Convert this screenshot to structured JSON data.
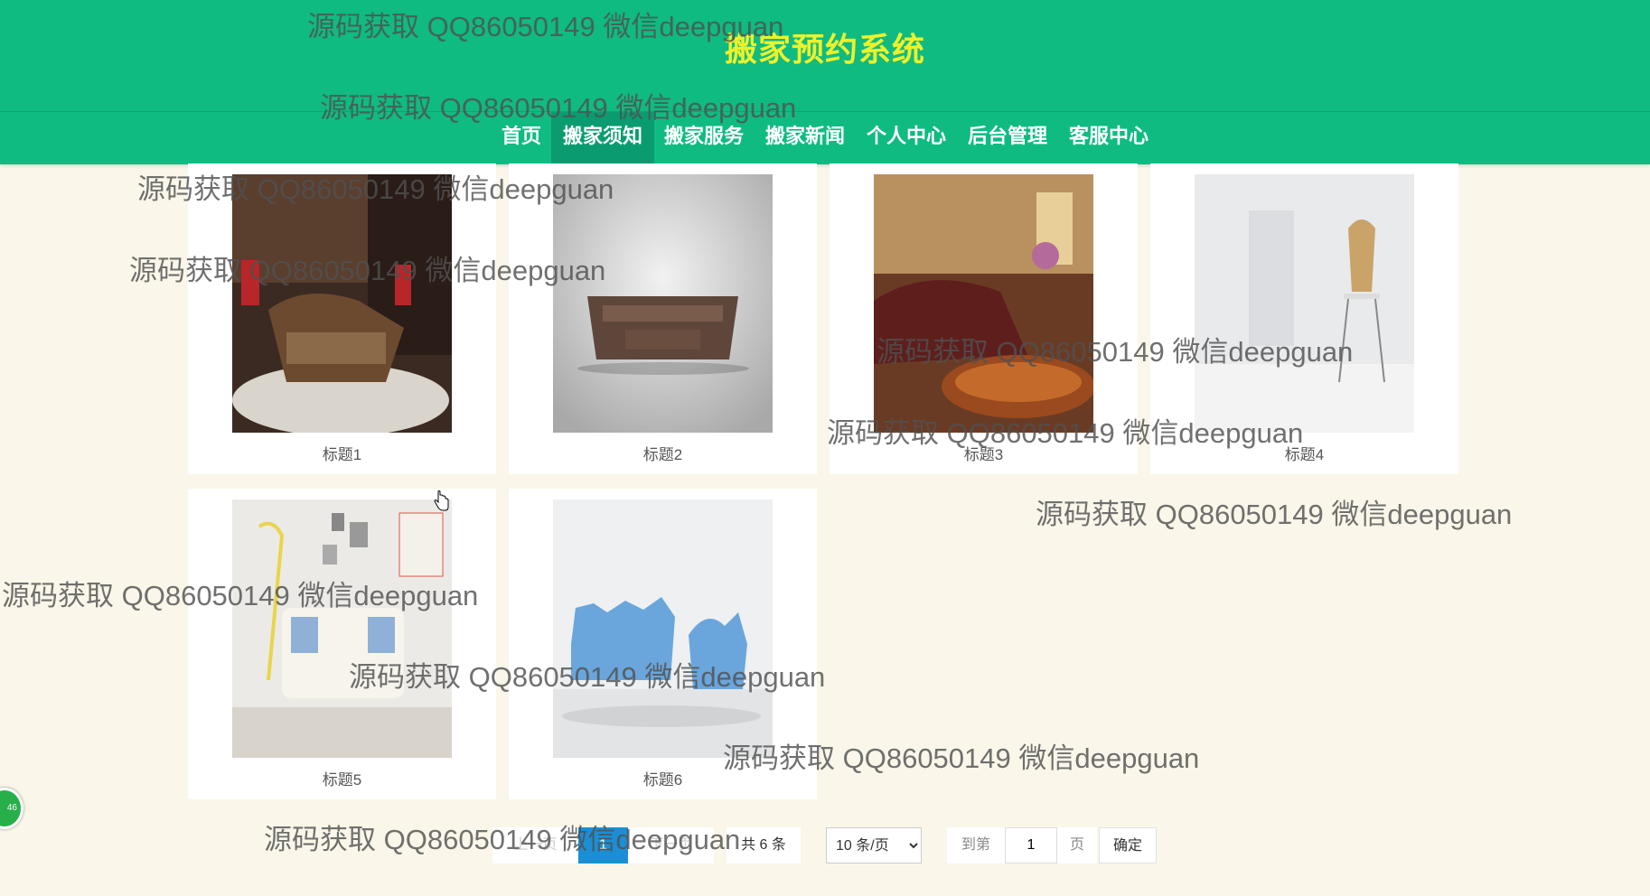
{
  "header": {
    "title": "搬家预约系统"
  },
  "nav": {
    "items": [
      {
        "label": "首页"
      },
      {
        "label": "搬家须知",
        "active": true
      },
      {
        "label": "搬家服务"
      },
      {
        "label": "搬家新闻"
      },
      {
        "label": "个人中心"
      },
      {
        "label": "后台管理"
      },
      {
        "label": "客服中心"
      }
    ]
  },
  "cards": [
    {
      "caption": "标题1",
      "image": "luxury-bedroom-photo"
    },
    {
      "caption": "标题2",
      "image": "wooden-tv-stand-photo"
    },
    {
      "caption": "标题3",
      "image": "leather-sofa-livingroom-photo"
    },
    {
      "caption": "标题4",
      "image": "chair-white-room-photo"
    },
    {
      "caption": "标题5",
      "image": "white-armchair-photo"
    },
    {
      "caption": "标题6",
      "image": "blue-sofa-photo"
    }
  ],
  "pagination": {
    "prev": "上一页",
    "current": "1",
    "next": "下一页",
    "total": "共 6 条",
    "page_size": "10 条/页",
    "goto_label": "到第",
    "goto_value": "1",
    "page_unit": "页",
    "confirm": "确定"
  },
  "watermark": "源码获取 QQ86050149 微信deepguan",
  "badge": "46",
  "colors": {
    "header_bg": "#0fbb81",
    "title": "#eef12a",
    "page_bg": "#faf6ea",
    "pager_current": "#1a8fd6"
  }
}
